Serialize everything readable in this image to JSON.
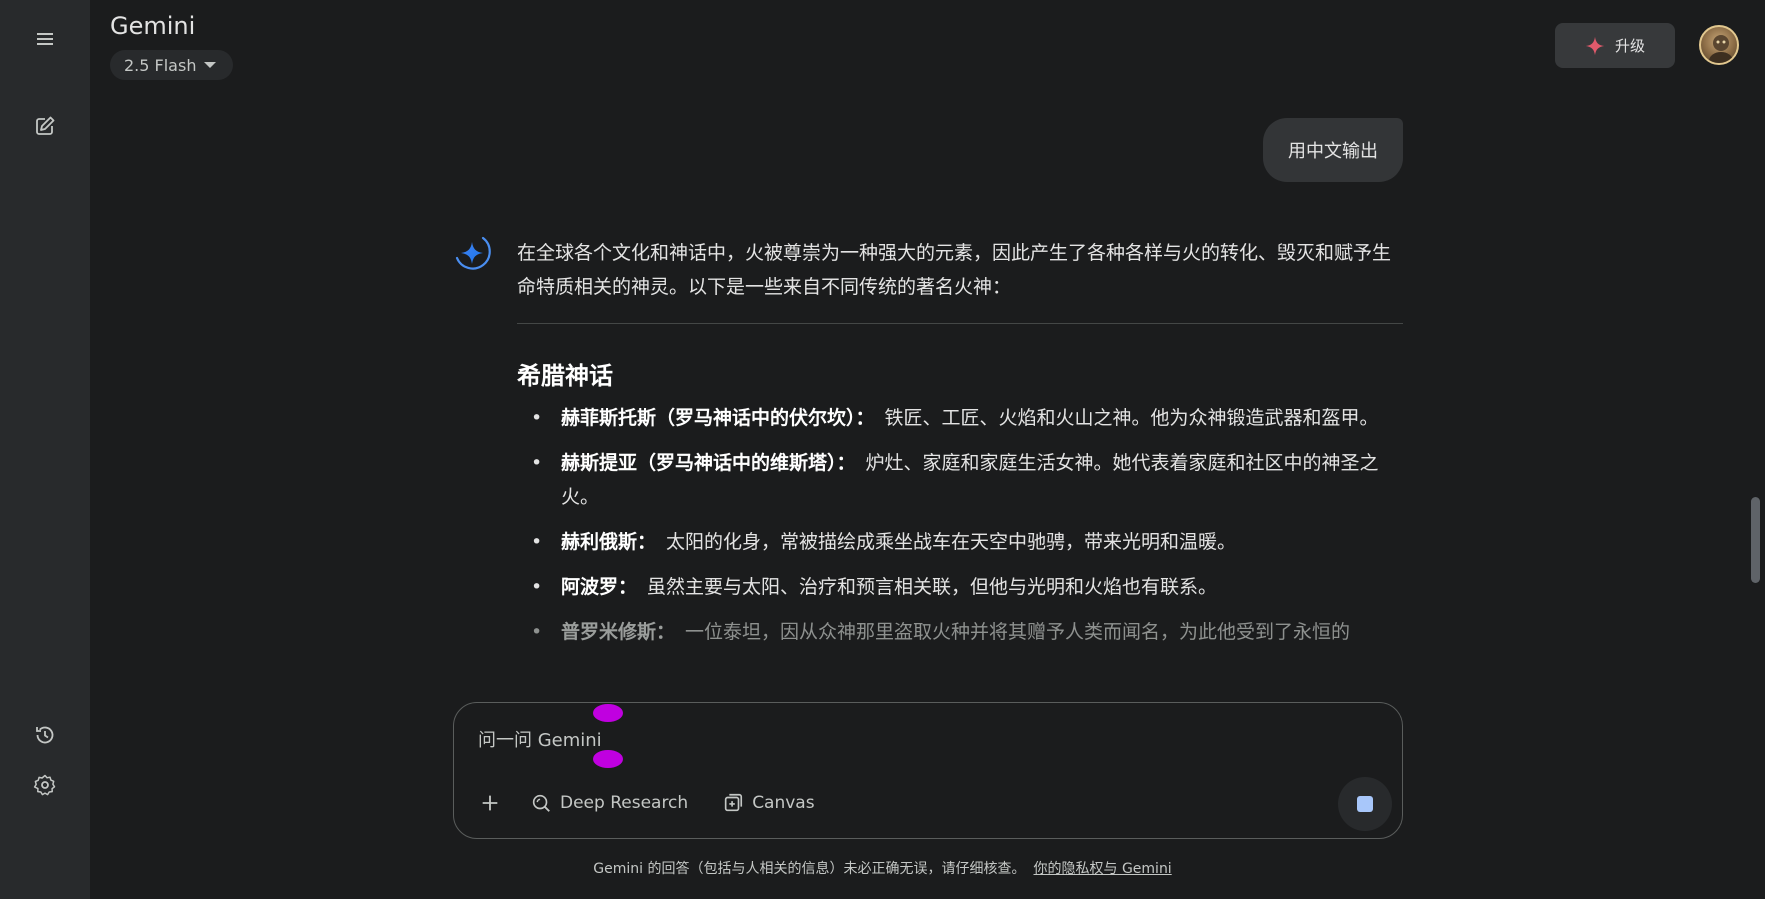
{
  "header": {
    "title": "Gemini",
    "model": "2.5 Flash",
    "upgrade_label": "升级"
  },
  "conversation": {
    "user_message": "用中文输出",
    "response": {
      "intro": "在全球各个文化和神话中，火被尊崇为一种强大的元素，因此产生了各种各样与火的转化、毁灭和赋予生命特质相关的神灵。以下是一些来自不同传统的著名火神：",
      "section_title": "希腊神话",
      "items": [
        {
          "name": "赫菲斯托斯（罗马神话中的伏尔坎）：",
          "desc": "铁匠、工匠、火焰和火山之神。他为众神锻造武器和盔甲。"
        },
        {
          "name": "赫斯提亚（罗马神话中的维斯塔）：",
          "desc": "炉灶、家庭和家庭生活女神。她代表着家庭和社区中的神圣之火。"
        },
        {
          "name": "赫利俄斯：",
          "desc": "太阳的化身，常被描绘成乘坐战车在天空中驰骋，带来光明和温暖。"
        },
        {
          "name": "阿波罗：",
          "desc": "虽然主要与太阳、治疗和预言相关联，但他与光明和火焰也有联系。"
        },
        {
          "name": "普罗米修斯：",
          "desc": "一位泰坦，因从众神那里盗取火种并将其赠予人类而闻名，为此他受到了永恒的"
        }
      ]
    }
  },
  "prompt": {
    "placeholder": "问一问 Gemini",
    "tools": {
      "deep_research": "Deep Research",
      "canvas": "Canvas"
    }
  },
  "footer": {
    "disclaimer": "Gemini 的回答（包括与人相关的信息）未必正确无误，请仔细核查。",
    "privacy_link": "你的隐私权与 Gemini"
  },
  "colors": {
    "background": "#1b1c1d",
    "sidebar": "#282a2c",
    "accent_blue": "#a8c7fa",
    "gemini_gradient_start": "#4285f4",
    "upgrade_spark": "#e05a6b",
    "cursor_marker": "#c000e0"
  }
}
